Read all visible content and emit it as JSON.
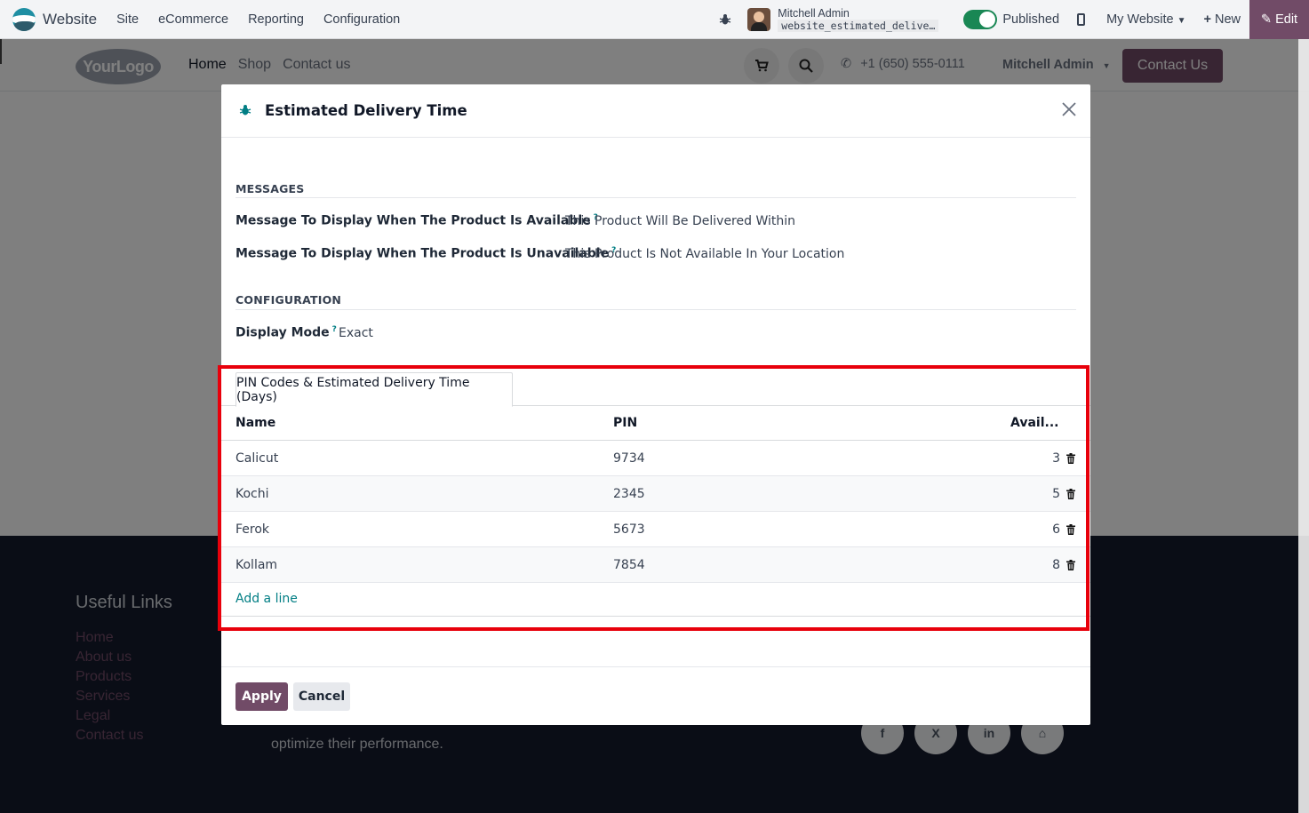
{
  "topbar": {
    "app_name": "Website",
    "menu": [
      "Site",
      "eCommerce",
      "Reporting",
      "Configuration"
    ],
    "user_name": "Mitchell Admin",
    "database": "website_estimated_delive…",
    "published_label": "Published",
    "website_selector": "My Website",
    "new_label": "New",
    "edit_label": "Edit"
  },
  "site": {
    "logo_text": "YourLogo",
    "nav": [
      "Home",
      "Shop",
      "Contact us"
    ],
    "phone": "+1 (650) 555-0111",
    "user": "Mitchell Admin",
    "contact_button": "Contact Us"
  },
  "footer": {
    "useful_links_title": "Useful Links",
    "links": [
      "Home",
      "About us",
      "Products",
      "Services",
      "Legal",
      "Contact us"
    ],
    "about_text": "optimize their performance.",
    "social": [
      "f",
      "X",
      "in",
      "⌂"
    ]
  },
  "modal": {
    "title": "Estimated Delivery Time",
    "messages_section": "MESSAGES",
    "available_label": "Message To Display When The Product Is Available",
    "available_value": "This Product Will Be Delivered Within",
    "unavailable_label": "Message To Display When The Product Is Unavailable",
    "unavailable_value": "This Product Is Not Available In Your Location",
    "config_section": "CONFIGURATION",
    "display_mode_label": "Display Mode",
    "display_mode_value": "Exact",
    "help_marker": "?",
    "tab_label": "PIN Codes & Estimated Delivery Time (Days)",
    "columns": [
      "Name",
      "PIN",
      "Avail..."
    ],
    "rows": [
      {
        "name": "Calicut",
        "pin": "9734",
        "avail": "3"
      },
      {
        "name": "Kochi",
        "pin": "2345",
        "avail": "5"
      },
      {
        "name": "Ferok",
        "pin": "5673",
        "avail": "6"
      },
      {
        "name": "Kollam",
        "pin": "7854",
        "avail": "8"
      }
    ],
    "add_line": "Add a line",
    "apply_label": "Apply",
    "cancel_label": "Cancel"
  },
  "colors": {
    "brand": "#714b67",
    "link": "#017e84",
    "highlight": "#e8000b",
    "published": "#198754"
  }
}
